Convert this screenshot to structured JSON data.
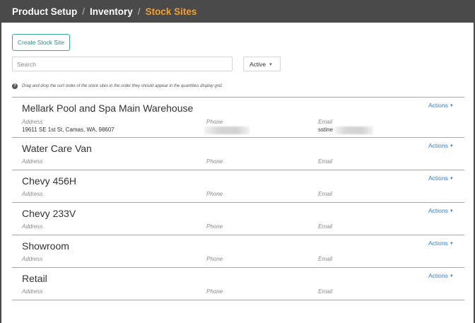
{
  "breadcrumb": {
    "items": [
      "Product Setup",
      "Inventory",
      "Stock Sites"
    ],
    "separator": "/"
  },
  "toolbar": {
    "create_label": "Create Stock Site",
    "search_placeholder": "Search",
    "status_value": "Active"
  },
  "hint": {
    "text": "Drag and drop the sort order of the stock sites in the order they should appear in the quantities display grid."
  },
  "labels": {
    "address": "Address",
    "phone": "Phone",
    "email": "Email",
    "actions": "Actions"
  },
  "sites": [
    {
      "name": "Mellark Pool and Spa Main Warehouse",
      "address": "19611 SE 1st St, Camas, WA, 98607",
      "email": "sstine"
    },
    {
      "name": "Water Care Van"
    },
    {
      "name": "Chevy 456H"
    },
    {
      "name": "Chevy 233V"
    },
    {
      "name": "Showroom"
    },
    {
      "name": "Retail"
    }
  ],
  "colors": {
    "topbar": "#4a4a4a",
    "active_crumb": "#f0a030",
    "accent": "#3aa89a",
    "link": "#3a7fc1"
  }
}
